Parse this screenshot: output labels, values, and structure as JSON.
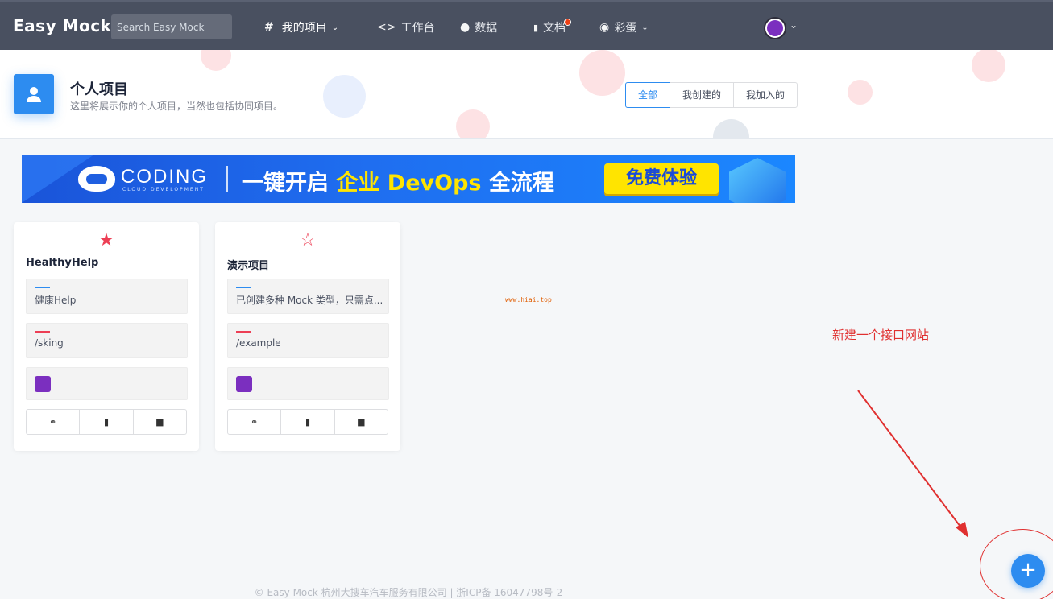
{
  "nav": {
    "brand": "Easy Mock",
    "search_placeholder": "Search Easy Mock",
    "items": [
      {
        "icon": "hash-icon",
        "label": "我的项目",
        "has_dropdown": true
      },
      {
        "icon": "code-icon",
        "label": "工作台"
      },
      {
        "icon": "dashboard-icon",
        "label": "数据"
      },
      {
        "icon": "book-icon",
        "label": "文档",
        "badge": true
      },
      {
        "icon": "egg-icon",
        "label": "彩蛋",
        "has_dropdown": true
      }
    ]
  },
  "header": {
    "title": "个人项目",
    "subtitle": "这里将展示你的个人项目，当然也包括协同项目。",
    "filters": [
      "全部",
      "我创建的",
      "我加入的"
    ],
    "active_filter": "全部"
  },
  "banner": {
    "brand": "CODING",
    "brand_sub": "CLOUD DEVELOPMENT",
    "slogan_part1": "一键开启 ",
    "slogan_highlight": "企业 DevOps",
    "slogan_part2": " 全流程",
    "cta": "免费体验"
  },
  "projects": [
    {
      "name": "HealthyHelp",
      "starred": true,
      "description": "健康Help",
      "url": "/sking"
    },
    {
      "name": "演示项目",
      "starred": false,
      "description": "已创建多种 Mock 类型，只需点...",
      "url": "/example"
    }
  ],
  "watermark": "www.hiai.top",
  "annotation": "新建一个接口网站",
  "footer": "© Easy Mock 杭州大搜车汽车服务有限公司 | 浙ICP备 16047798号-2",
  "colors": {
    "accent": "#2d8cf0",
    "nav_bg": "#495060",
    "star": "#ed3f55",
    "annotation": "#e03030"
  }
}
